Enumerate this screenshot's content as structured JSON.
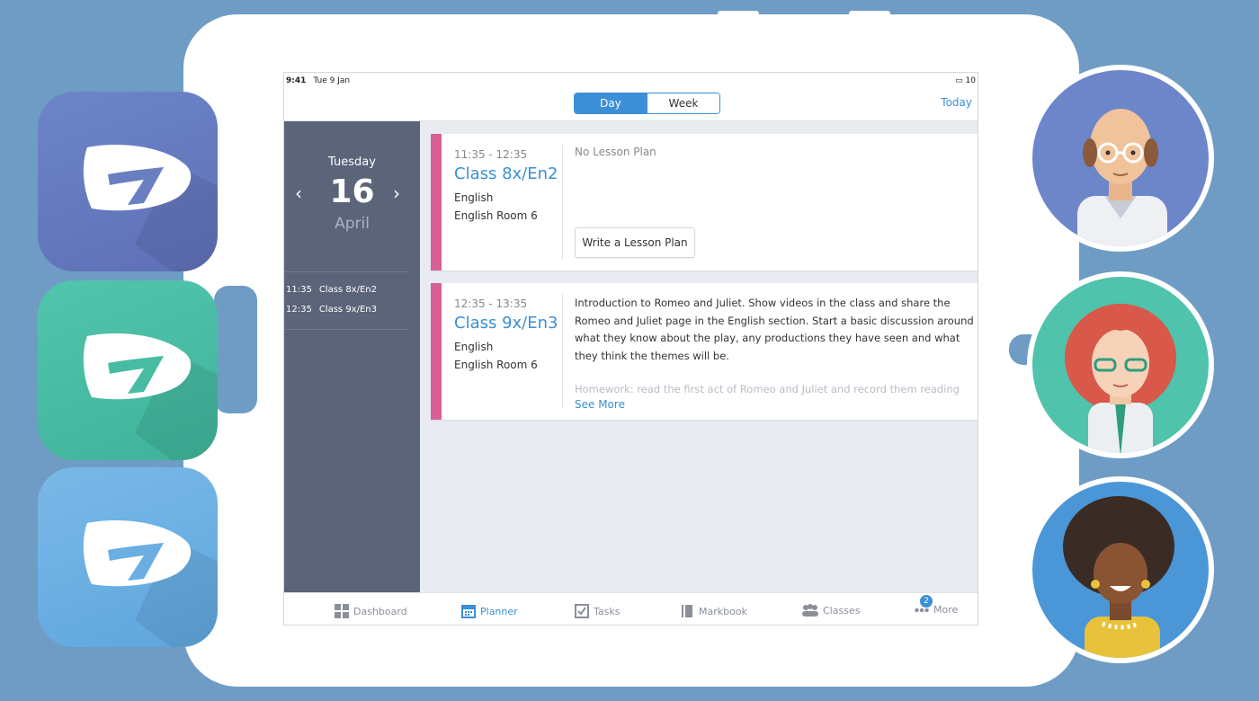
{
  "status": {
    "time": "9:41",
    "date": "Tue 9 Jan",
    "battery": "10"
  },
  "nav": {
    "segment_day": "Day",
    "segment_week": "Week",
    "today": "Today"
  },
  "sidebar": {
    "weekday": "Tuesday",
    "day": "16",
    "month": "April",
    "prev_icon": "chevron-left-icon",
    "next_icon": "chevron-right-icon",
    "items": [
      {
        "time": "11:35",
        "label": "Class 8x/En2"
      },
      {
        "time": "12:35",
        "label": "Class 9x/En3"
      }
    ]
  },
  "lessons": [
    {
      "time": "11:35 - 12:35",
      "class": "Class 8x/En2",
      "subject": "English",
      "room": "English Room 6",
      "status": "No Lesson Plan",
      "button": "Write a Lesson Plan"
    },
    {
      "time": "12:35 - 13:35",
      "class": "Class 9x/En3",
      "subject": "English",
      "room": "English Room 6",
      "description": "Introduction to Romeo and Juliet. Show videos in the class and share the Romeo and Juliet page in the English section. Start a basic discussion around what they know about the play, any productions they have seen and what they think the themes will be.",
      "homework": "Homework: read the first act of Romeo and Juliet and record them reading",
      "see_more": "See More"
    }
  ],
  "tabs": [
    {
      "label": "Dashboard",
      "icon": "dashboard-icon"
    },
    {
      "label": "Planner",
      "icon": "calendar-icon",
      "active": true
    },
    {
      "label": "Tasks",
      "icon": "checkbox-icon"
    },
    {
      "label": "Markbook",
      "icon": "book-icon"
    },
    {
      "label": "Classes",
      "icon": "people-icon"
    },
    {
      "label": "More",
      "icon": "more-icon",
      "badge": "2"
    }
  ],
  "colors": {
    "accent": "#3a8fd6",
    "lesson_bar": "#d85f96",
    "sidebar_bg": "#5b6479",
    "background": "#6f9cc4"
  }
}
